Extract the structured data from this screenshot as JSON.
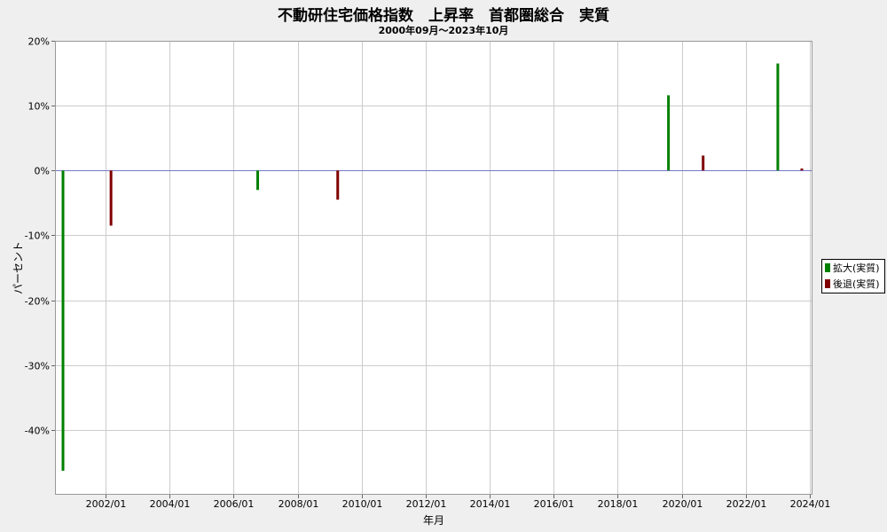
{
  "header": {
    "title": "不動研住宅価格指数　上昇率　首都圏総合　実質",
    "subtitle": "2000年09月～2023年10月"
  },
  "colors": {
    "background": "#efefef",
    "plot_background": "#ffffff",
    "grid": "#cccccc",
    "zero_line": "#7777cc",
    "expansion": "#008000",
    "recession": "#800000"
  },
  "legend": {
    "placement": "right",
    "items": [
      {
        "label": "拡大(実質)",
        "color": "#008000"
      },
      {
        "label": "後退(実質)",
        "color": "#800000"
      }
    ]
  },
  "chart_data": {
    "type": "bar",
    "title": "不動研住宅価格指数　上昇率　首都圏総合　実質",
    "subtitle": "2000年09月～2023年10月",
    "xlabel": "年月",
    "ylabel": "パーセント",
    "ylim": [
      -50,
      20
    ],
    "xlim": [
      "2000-06",
      "2024-02"
    ],
    "yticks": [
      20,
      10,
      0,
      -10,
      -20,
      -30,
      -40
    ],
    "ytick_labels": [
      "20%",
      "10%",
      "0%",
      "-10%",
      "-20%",
      "-30%",
      "-40%"
    ],
    "xticks": [
      "2002/01",
      "2004/01",
      "2006/01",
      "2008/01",
      "2010/01",
      "2012/01",
      "2014/01",
      "2016/01",
      "2018/01",
      "2020/01",
      "2022/01",
      "2024/01"
    ],
    "grid": true,
    "legend_position": "right",
    "series": [
      {
        "name": "拡大(実質)",
        "color": "#008000",
        "points": [
          {
            "x": "2000-09",
            "y": -46.3
          },
          {
            "x": "2006-10",
            "y": -3.0
          },
          {
            "x": "2019-08",
            "y": 11.6
          },
          {
            "x": "2023-01",
            "y": 16.5
          }
        ]
      },
      {
        "name": "後退(実質)",
        "color": "#800000",
        "points": [
          {
            "x": "2002-03",
            "y": -8.5
          },
          {
            "x": "2009-04",
            "y": -4.5
          },
          {
            "x": "2020-09",
            "y": 2.3
          },
          {
            "x": "2023-10",
            "y": 0.3
          }
        ]
      }
    ]
  }
}
